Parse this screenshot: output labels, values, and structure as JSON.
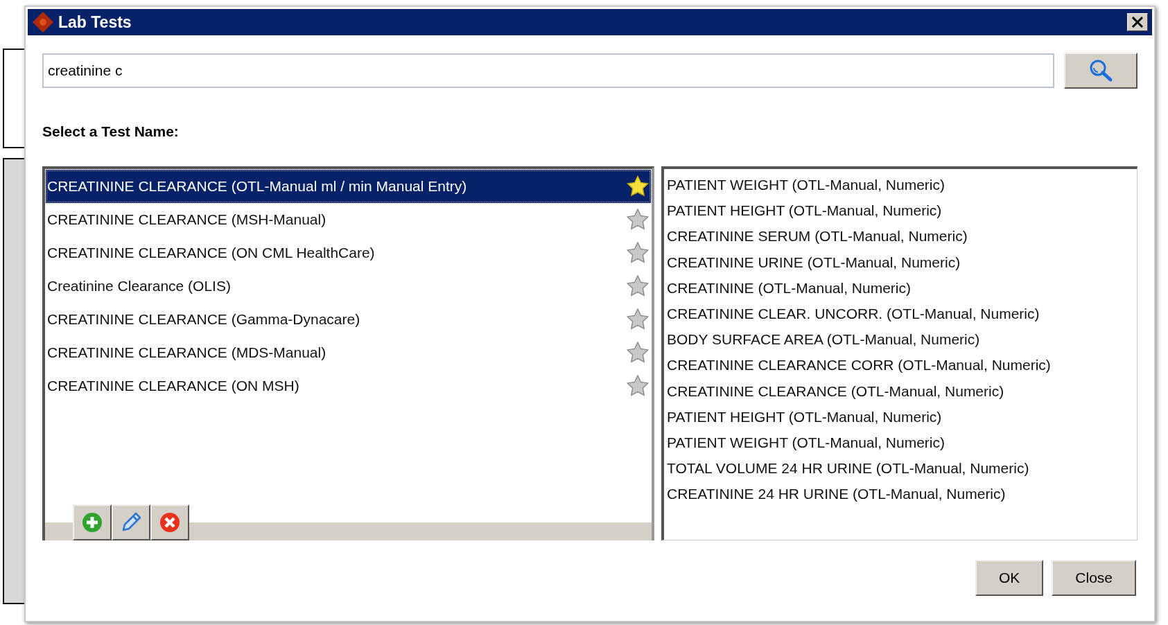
{
  "window": {
    "title": "Lab Tests"
  },
  "search": {
    "value": "creatinine c"
  },
  "label": "Select a Test Name:",
  "tests": [
    {
      "name": "CREATININE CLEARANCE (OTL-Manual ml / min Manual Entry)",
      "selected": true,
      "favorite": true
    },
    {
      "name": "CREATININE CLEARANCE (MSH-Manual)",
      "selected": false,
      "favorite": false
    },
    {
      "name": "CREATININE CLEARANCE (ON CML HealthCare)",
      "selected": false,
      "favorite": false
    },
    {
      "name": "Creatinine Clearance (OLIS)",
      "selected": false,
      "favorite": false
    },
    {
      "name": "CREATININE CLEARANCE (Gamma-Dynacare)",
      "selected": false,
      "favorite": false
    },
    {
      "name": "CREATININE CLEARANCE (MDS-Manual)",
      "selected": false,
      "favorite": false
    },
    {
      "name": "CREATININE CLEARANCE (ON MSH)",
      "selected": false,
      "favorite": false
    }
  ],
  "components": [
    "PATIENT WEIGHT (OTL-Manual, Numeric)",
    "PATIENT HEIGHT (OTL-Manual, Numeric)",
    "CREATININE SERUM (OTL-Manual, Numeric)",
    "CREATININE URINE (OTL-Manual, Numeric)",
    "CREATININE (OTL-Manual, Numeric)",
    "CREATININE CLEAR. UNCORR. (OTL-Manual, Numeric)",
    "BODY SURFACE AREA (OTL-Manual, Numeric)",
    "CREATININE CLEARANCE CORR (OTL-Manual, Numeric)",
    "CREATININE CLEARANCE (OTL-Manual, Numeric)",
    "PATIENT HEIGHT (OTL-Manual, Numeric)",
    "PATIENT WEIGHT (OTL-Manual, Numeric)",
    "TOTAL VOLUME 24 HR URINE (OTL-Manual, Numeric)",
    "CREATININE 24 HR URINE (OTL-Manual, Numeric)"
  ],
  "buttons": [
    "OK",
    "Close"
  ]
}
